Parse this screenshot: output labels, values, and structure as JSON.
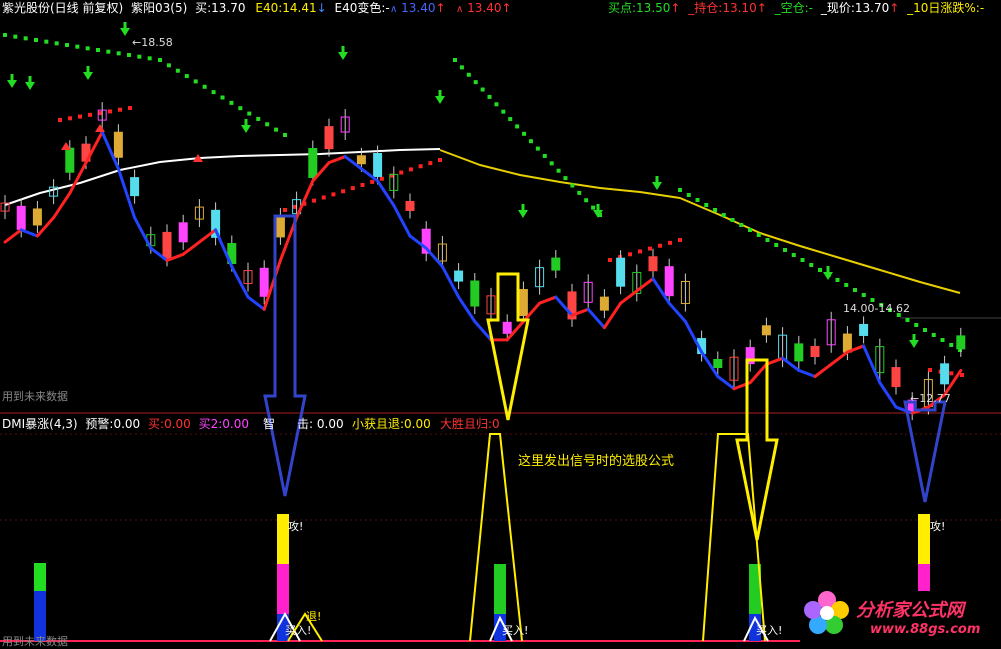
{
  "header": {
    "title": "紫光股份(日线 前复权)",
    "indicator_name": "紫阳03(5)",
    "buy_label": "买:",
    "buy_value": "13.70",
    "e40_label": "E40:",
    "e40_value": "14.41",
    "e40_color_label": "E40变色:",
    "e40_color_value": "-",
    "val_a": "13.40",
    "val_b": "13.40",
    "buy_point_label": "买点:",
    "buy_point_value": "13.50",
    "hold_label": "_持仓:",
    "hold_value": "13.10",
    "empty_label": "_空仓:",
    "empty_value": "-",
    "price_label": "_现价:",
    "price_value": "13.70",
    "ten_day_label": "_10日涨跌%:",
    "ten_day_value": "-"
  },
  "main_panel": {
    "future_data_note": "用到未来数据",
    "high_label": "18.58",
    "range_label": "14.00-14.62",
    "low_label": "12.77"
  },
  "indicator_header": {
    "name": "DMI暴涨(4,3)",
    "warn_label": "预警:",
    "warn_value": "0.00",
    "buy_label": "买:",
    "buy_value": "0.00",
    "buy2_label": "买2:",
    "buy2_value": "0.00",
    "smart_label": "智",
    "smart_label_tail": "击:",
    "smart_value": "0.00",
    "small_label": "小获且退:",
    "small_value": "0.00",
    "big_label": "大胜且归:",
    "big_value": "0"
  },
  "sub_panel": {
    "annotation": "这里发出信号时的选股公式",
    "attack_label": "攻!",
    "retreat_label": "退!",
    "buy_signal_label": "买入!",
    "future_data_note": "用到未来数据"
  },
  "watermark": {
    "brand": "分析家公式网",
    "url": "www.88gs.com"
  },
  "colors": {
    "background": "#000000",
    "up_candle": "#ff3333",
    "down_candle": "#55ddee",
    "ma_up": "#ff2222",
    "ma_down": "#2244ff",
    "white_line": "#ffffff",
    "yellow_line": "#e8d000",
    "dots_green": "#22dd22",
    "dots_red": "#ff2222",
    "arrow_blue": "#3344cc",
    "arrow_yellow": "#ffee00"
  },
  "chart_data": {
    "type": "candlestick",
    "price_levels": {
      "high": 18.58,
      "range_low": 14.0,
      "range_high": 14.62,
      "low": 12.77,
      "current": 13.7
    },
    "blue_red_line": [
      15.6,
      15.8,
      15.7,
      16.0,
      16.4,
      16.9,
      17.4,
      16.8,
      16.0,
      15.5,
      15.3,
      15.4,
      15.6,
      15.8,
      15.2,
      14.7,
      14.5,
      15.3,
      16.0,
      16.6,
      16.9,
      17.0,
      16.8,
      16.6,
      16.2,
      15.7,
      15.5,
      15.2,
      14.7,
      14.3,
      14.0,
      14.0,
      14.3,
      14.6,
      14.7,
      14.4,
      14.5,
      14.2,
      14.6,
      14.8,
      15.0,
      14.6,
      14.3,
      13.8,
      13.4,
      13.2,
      13.3,
      13.6,
      13.7,
      13.5,
      13.4,
      13.6,
      13.8,
      13.9,
      13.3,
      12.9,
      12.8,
      12.9,
      13.1,
      13.5
    ]
  }
}
